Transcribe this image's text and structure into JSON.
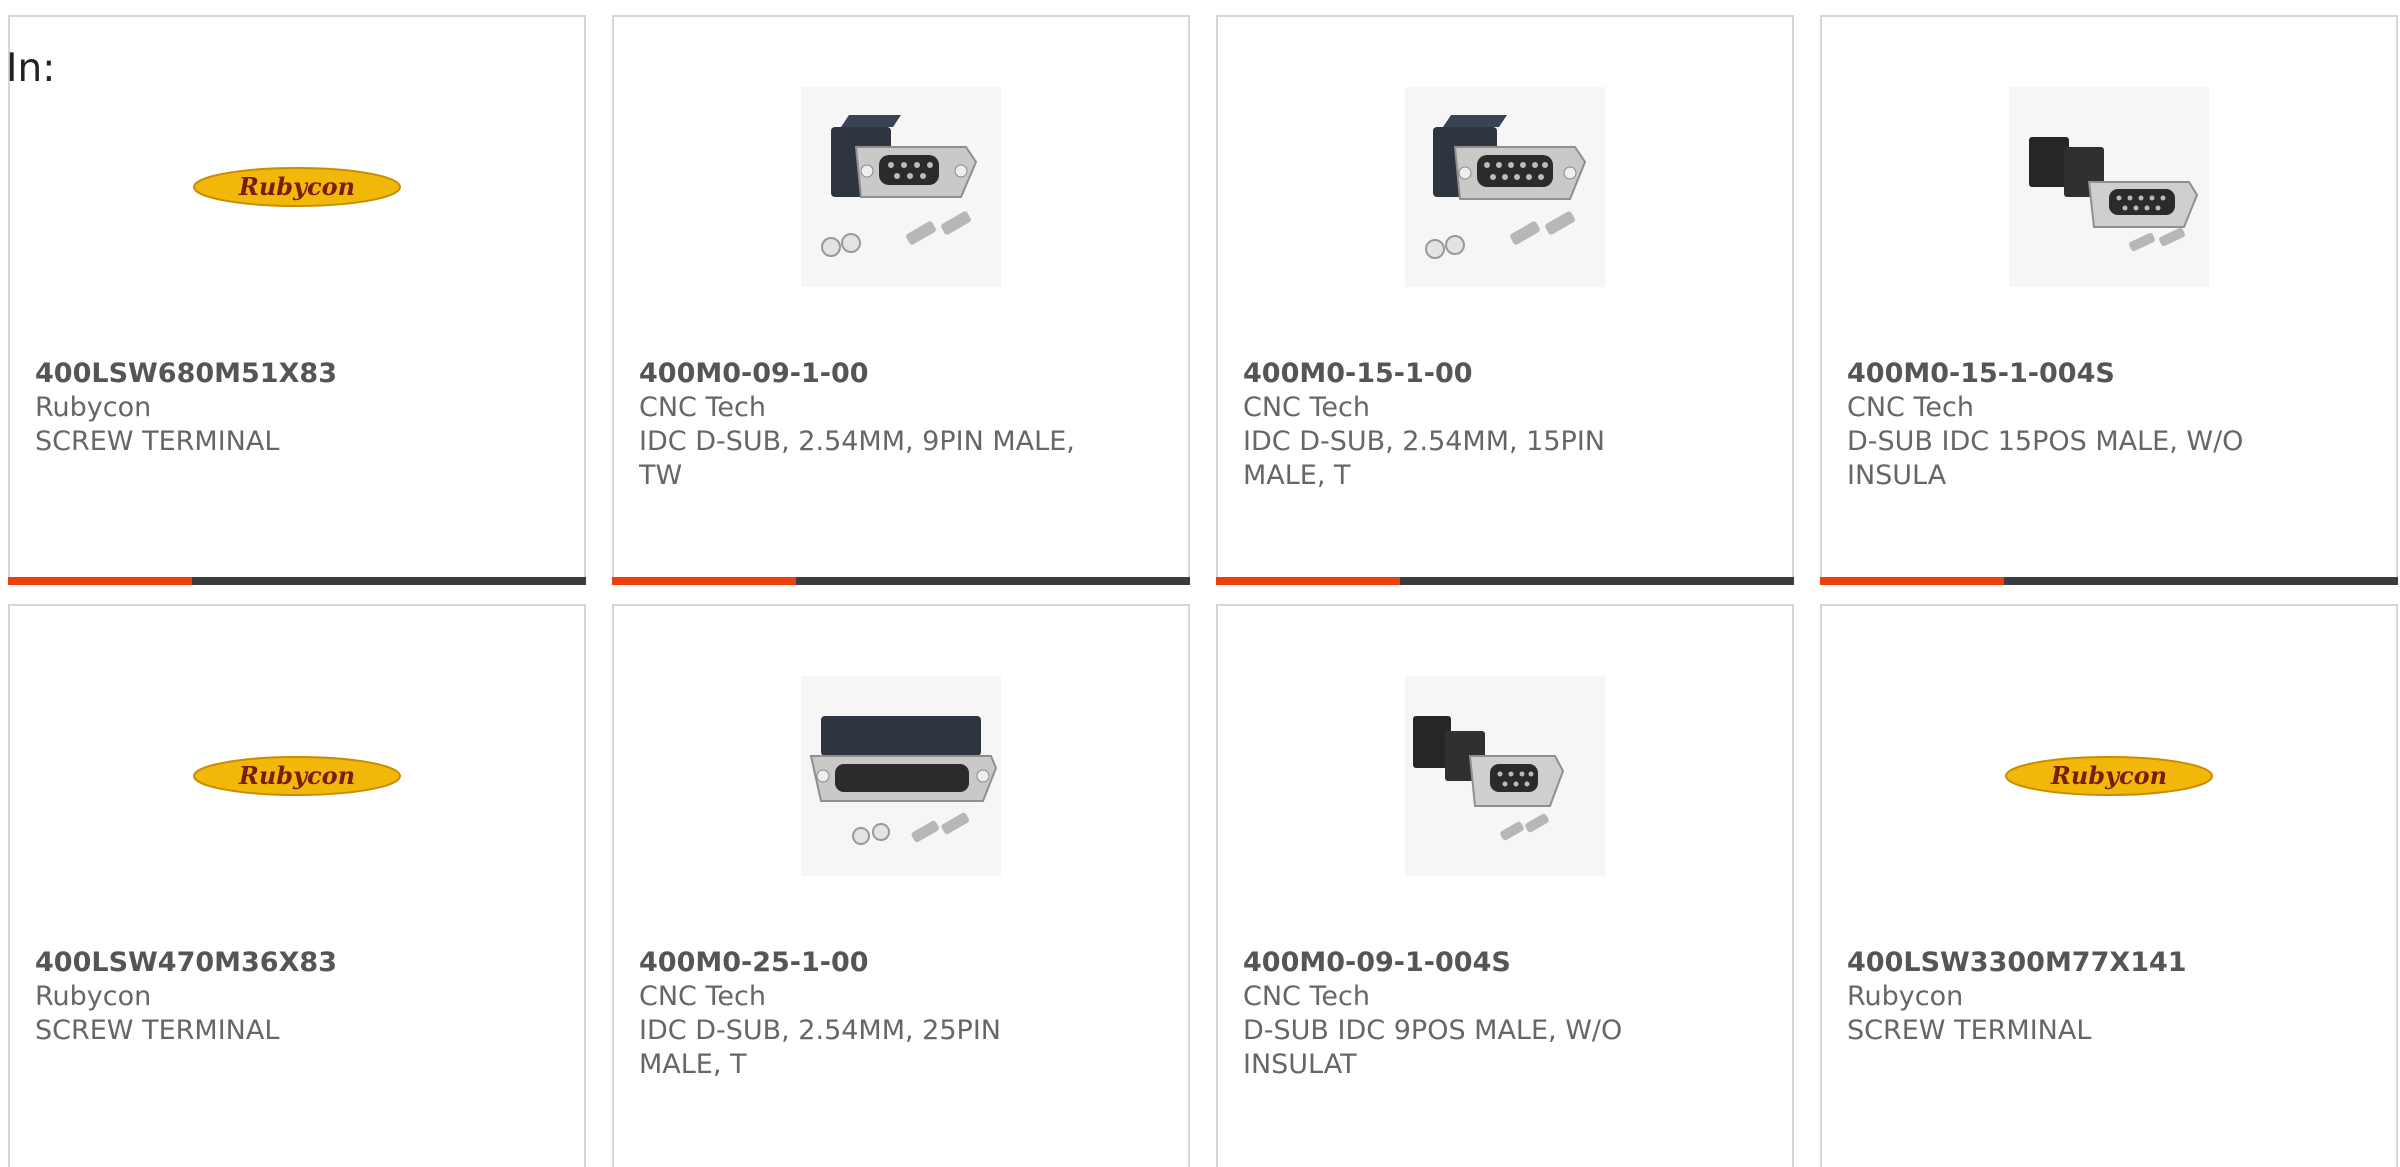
{
  "header": {
    "label": "In:"
  },
  "cards": [
    {
      "part": "400LSW680M51X83",
      "maker": "Rubycon",
      "desc": "SCREW TERMINAL",
      "image": "rubycon-logo"
    },
    {
      "part": "400M0-09-1-00",
      "maker": "CNC Tech",
      "desc": "IDC D-SUB, 2.54MM, 9PIN MALE, TW",
      "image": "dsub-9-connector-with-hardware"
    },
    {
      "part": "400M0-15-1-00",
      "maker": "CNC Tech",
      "desc": "IDC D-SUB, 2.54MM, 15PIN MALE, T",
      "image": "dsub-15-connector-with-hardware"
    },
    {
      "part": "400M0-15-1-004S",
      "maker": "CNC Tech",
      "desc": "D-SUB IDC 15POS MALE, W/O INSULA",
      "image": "dsub-15-connector-kit"
    },
    {
      "part": "400LSW470M36X83",
      "maker": "Rubycon",
      "desc": "SCREW TERMINAL",
      "image": "rubycon-logo"
    },
    {
      "part": "400M0-25-1-00",
      "maker": "CNC Tech",
      "desc": "IDC D-SUB, 2.54MM, 25PIN MALE, T",
      "image": "dsub-25-connector-with-hardware"
    },
    {
      "part": "400M0-09-1-004S",
      "maker": "CNC Tech",
      "desc": "D-SUB IDC 9POS MALE, W/O INSULAT",
      "image": "dsub-9-connector-kit"
    },
    {
      "part": "400LSW3300M77X141",
      "maker": "Rubycon",
      "desc": "SCREW TERMINAL",
      "image": "rubycon-logo"
    }
  ],
  "logo": {
    "text": "Rubycon"
  },
  "colors": {
    "accent": "#e9410f",
    "bar": "#3c3c3c",
    "logo_fill": "#f1b80a",
    "logo_text": "#7a1c10"
  }
}
